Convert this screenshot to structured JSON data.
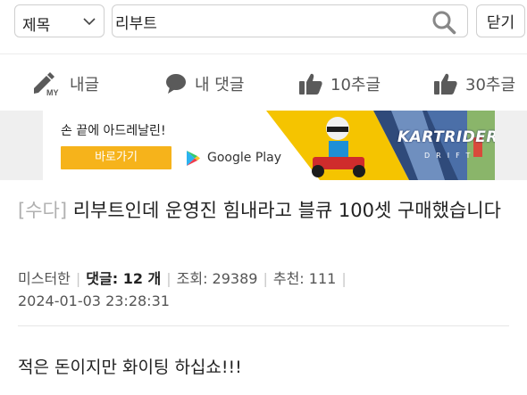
{
  "search": {
    "field_select": "제목",
    "query": "리부트",
    "close_label": "닫기"
  },
  "nav": {
    "my_badge": "MY",
    "my_posts": "내글",
    "my_comments": "내 댓글",
    "top10": "10추글",
    "top30": "30추글"
  },
  "ad": {
    "tagline": "손 끝에 아드레날린!",
    "cta": "바로가기",
    "store": "Google Play",
    "brand": "KARTRIDER",
    "brand_sub": "DRIFT",
    "colors": {
      "cta": "#f6b31b",
      "art": "#f5c400"
    }
  },
  "post": {
    "category": "[수다]",
    "title": "리부트인데 운영진 힘내라고 블큐 100셋 구매했습니다",
    "author": "미스터한",
    "comments_label": "댓글: 12 개",
    "views": "조회: 29389",
    "likes": "추천: 111",
    "datetime": "2024-01-03 23:28:31",
    "body": "적은 돈이지만 화이팅 하십쇼!!!"
  }
}
